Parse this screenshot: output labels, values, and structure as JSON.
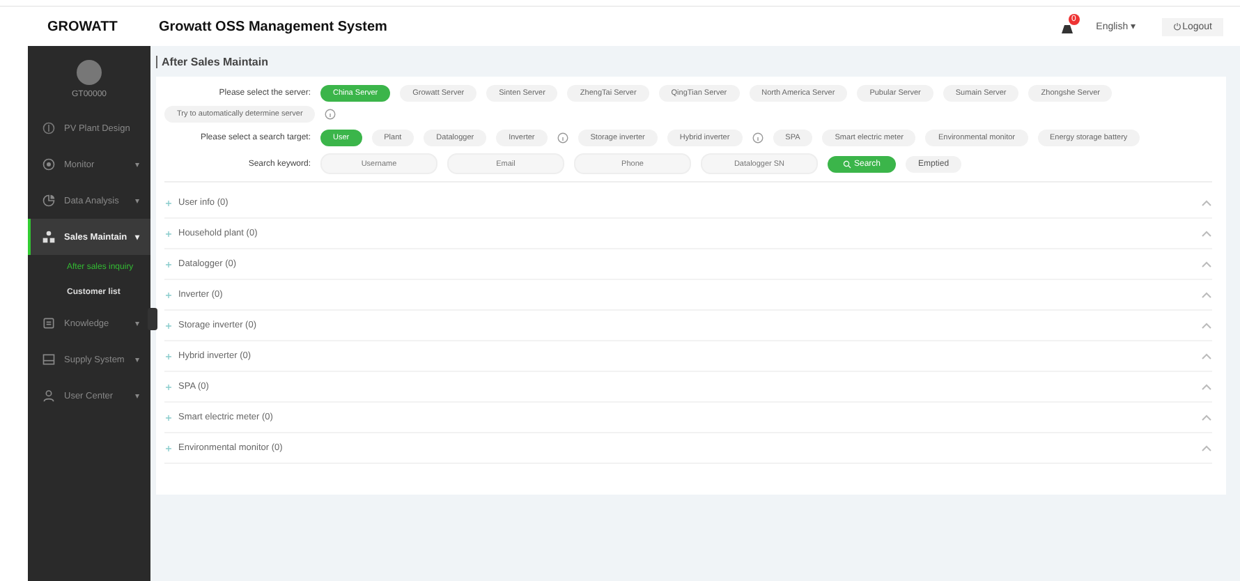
{
  "header": {
    "logo": "GROWATT",
    "title": "Growatt OSS Management System",
    "notification_count": "0",
    "language": "English",
    "language_caret": "▾",
    "logout": "Logout"
  },
  "sidebar": {
    "username": "GT00000",
    "items": [
      {
        "label": "PV Plant Design",
        "selected": false
      },
      {
        "label": "Monitor",
        "caret": "▾",
        "selected": false
      },
      {
        "label": "Data Analysis",
        "caret": "▾",
        "selected": false
      },
      {
        "label": "Sales Maintain",
        "caret": "▾",
        "selected": true,
        "children": [
          {
            "label": "After sales inquiry",
            "selected": true
          },
          {
            "label": "Customer list",
            "selected": false
          }
        ]
      },
      {
        "label": "Knowledge",
        "caret": "▾",
        "selected": false
      },
      {
        "label": "Supply System",
        "caret": "▾",
        "selected": false
      },
      {
        "label": "User Center",
        "caret": "▾",
        "selected": false
      }
    ]
  },
  "page_title": "After Sales Maintain",
  "server": {
    "label": "Please select the server:",
    "options": [
      {
        "label": "China Server",
        "selected": true
      },
      {
        "label": "Growatt Server",
        "selected": false
      },
      {
        "label": "Sinten Server",
        "selected": false
      },
      {
        "label": "ZhengTai Server",
        "selected": false
      },
      {
        "label": "QingTian Server",
        "selected": false
      },
      {
        "label": "North America Server",
        "selected": false
      },
      {
        "label": "Pubular Server",
        "selected": false
      },
      {
        "label": "Sumain Server",
        "selected": false
      },
      {
        "label": "Zhongshe Server",
        "selected": false
      }
    ],
    "auto_label": "Try to automatically determine server"
  },
  "target": {
    "label": "Please select a search target:",
    "options": [
      {
        "label": "User",
        "selected": true,
        "info": false
      },
      {
        "label": "Plant",
        "selected": false,
        "info": false
      },
      {
        "label": "Datalogger",
        "selected": false,
        "info": false
      },
      {
        "label": "Inverter",
        "selected": false,
        "info": true
      },
      {
        "label": "Storage inverter",
        "selected": false,
        "info": false
      },
      {
        "label": "Hybrid inverter",
        "selected": false,
        "info": true
      },
      {
        "label": "SPA",
        "selected": false,
        "info": false
      },
      {
        "label": "Smart electric meter",
        "selected": false,
        "info": false
      },
      {
        "label": "Environmental monitor",
        "selected": false,
        "info": false
      },
      {
        "label": "Energy storage battery",
        "selected": false,
        "info": false
      }
    ]
  },
  "keyword": {
    "label": "Search keyword:",
    "fields": [
      {
        "placeholder": "Username"
      },
      {
        "placeholder": "Email"
      },
      {
        "placeholder": "Phone"
      },
      {
        "placeholder": "Datalogger SN"
      }
    ],
    "search": "Search",
    "empty": "Emptied"
  },
  "sections": [
    {
      "label": "User info (0)",
      "expanded": false
    },
    {
      "label": "Household plant (0)",
      "expanded": false
    },
    {
      "label": "Datalogger (0)",
      "expanded": false
    },
    {
      "label": "Inverter (0)",
      "expanded": false
    },
    {
      "label": "Storage inverter (0)",
      "expanded": false
    },
    {
      "label": "Hybrid inverter (0)",
      "expanded": false
    },
    {
      "label": "SPA (0)",
      "expanded": false
    },
    {
      "label": "Smart electric meter (0)",
      "expanded": false
    },
    {
      "label": "Environmental monitor (0)",
      "expanded": false
    }
  ]
}
